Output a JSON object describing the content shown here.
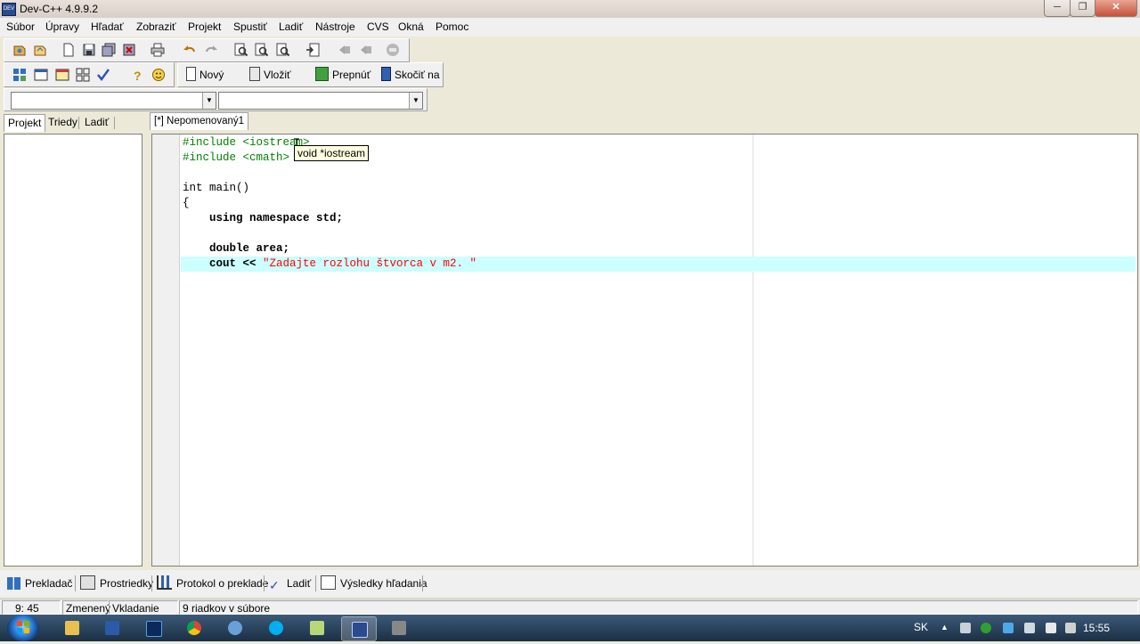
{
  "window": {
    "title": "Dev-C++ 4.9.9.2",
    "app_icon_text": "DEV"
  },
  "menu": [
    "Súbor",
    "Úpravy",
    "Hľadať",
    "Zobraziť",
    "Projekt",
    "Spustiť",
    "Ladiť",
    "Nástroje",
    "CVS",
    "Okná",
    "Pomoc"
  ],
  "toolbar2": {
    "new": "Nový",
    "insert": "Vložiť",
    "toggle": "Prepnúť",
    "goto": "Skočiť na"
  },
  "panel_tabs": [
    "Projekt",
    "Triedy",
    "Ladiť"
  ],
  "editor": {
    "tab_label": "[*] Nepomenovaný1",
    "lines": [
      {
        "text": "#include <iostream>",
        "kind": "pp"
      },
      {
        "text": "#include <cmath>",
        "kind": "pp"
      },
      {
        "text": "",
        "kind": "plain"
      },
      {
        "text": "int main()",
        "kind": "plain"
      },
      {
        "text": "{",
        "kind": "plain"
      },
      {
        "text": "    using namespace std;",
        "kind": "kw"
      },
      {
        "text": "",
        "kind": "plain"
      },
      {
        "text": "    double area;",
        "kind": "kw"
      },
      {
        "code": "    cout << ",
        "string": "\"Zadajte rozlohu štvorca v m2. \"",
        "kind": "mixed"
      }
    ],
    "tooltip": "void *iostream"
  },
  "bottom_tabs": [
    "Prekladač",
    "Prostriedky",
    "Protokol o preklade",
    "Ladiť",
    "Výsledky hľadania"
  ],
  "status": {
    "position": "9: 45",
    "modified": "Zmenený",
    "mode": "Vkladanie",
    "lines_info": "9 riadkov v súbore"
  },
  "taskbar": {
    "lang": "SK",
    "time": "15:55"
  },
  "colors": {
    "preprocessor": "#008000",
    "string": "#ff0000",
    "active_line": "#ccffff",
    "taskbar": "#2a4560"
  }
}
